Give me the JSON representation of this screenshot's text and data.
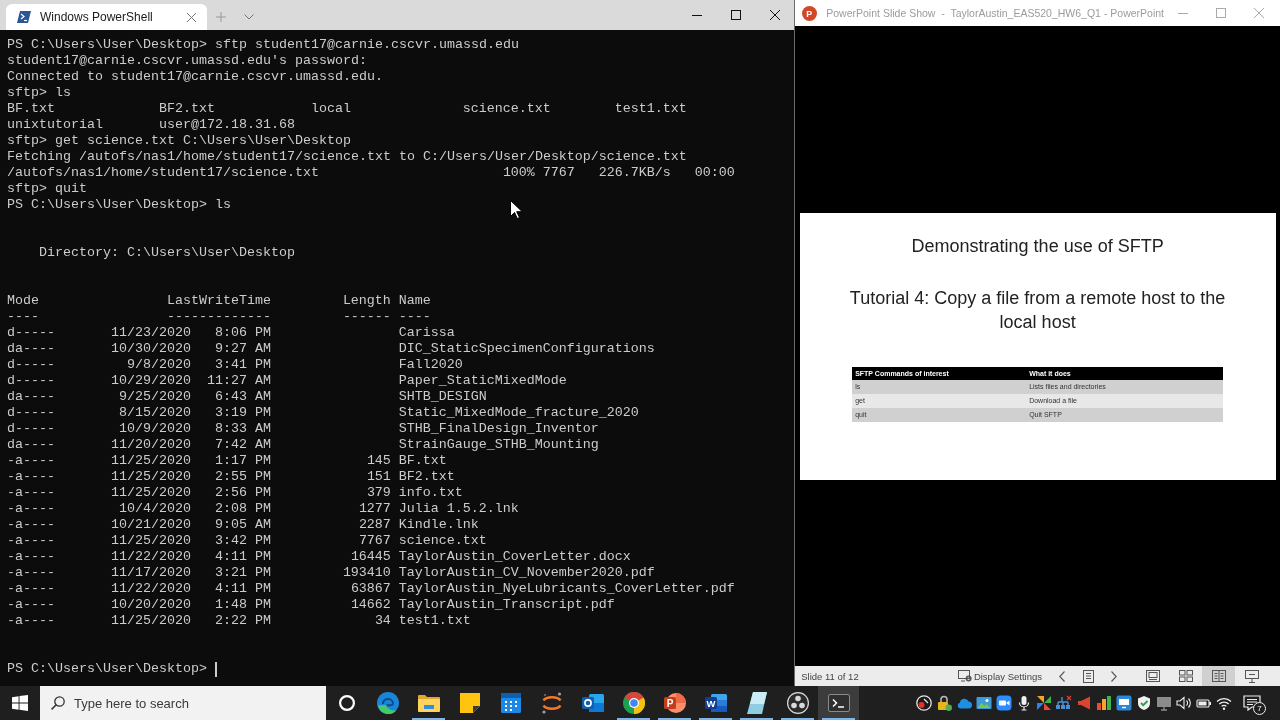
{
  "terminal": {
    "tab": {
      "title": "Windows PowerShell",
      "selected": true
    },
    "session": [
      {
        "kind": "text",
        "text": "PS C:\\Users\\User\\Desktop> sftp student17@carnie.cscvr.umassd.edu"
      },
      {
        "kind": "text",
        "text": "student17@carnie.cscvr.umassd.edu's password:"
      },
      {
        "kind": "text",
        "text": "Connected to student17@carnie.cscvr.umassd.edu."
      },
      {
        "kind": "text",
        "text": "sftp> ls"
      },
      {
        "kind": "columns",
        "cells": [
          "BF.txt",
          "BF2.txt",
          "local",
          "science.txt",
          "test1.txt"
        ]
      },
      {
        "kind": "columns",
        "cells": [
          "unixtutorial",
          "user@172.18.31.68"
        ]
      },
      {
        "kind": "text",
        "text": "sftp> get science.txt C:\\Users\\User\\Desktop"
      },
      {
        "kind": "text",
        "text": "Fetching /autofs/nas1/home/student17/science.txt to C:/Users/User/Desktop/science.txt"
      },
      {
        "kind": "transfer",
        "file": "/autofs/nas1/home/student17/science.txt",
        "percent": "100%",
        "size": "7767",
        "rate": "226.7KB/s",
        "eta": "00:00"
      },
      {
        "kind": "text",
        "text": "sftp> quit"
      },
      {
        "kind": "text",
        "text": "PS C:\\Users\\User\\Desktop> ls"
      }
    ],
    "directory": "Directory: C:\\Users\\User\\Desktop",
    "listing": {
      "columns": [
        "Mode",
        "LastWriteTime",
        "Length",
        "Name"
      ],
      "rules": [
        "----",
        "-------------",
        "------",
        "----"
      ],
      "rows": [
        {
          "mode": "d-----",
          "date": "11/23/2020",
          "time": "8:06 PM",
          "name": "Carissa"
        },
        {
          "mode": "da----",
          "date": "10/30/2020",
          "time": "9:27 AM",
          "name": "DIC_StaticSpecimenConfigurations"
        },
        {
          "mode": "d-----",
          "date": "9/8/2020",
          "time": "3:41 PM",
          "name": "Fall2020"
        },
        {
          "mode": "d-----",
          "date": "10/29/2020",
          "time": "11:27 AM",
          "name": "Paper_StaticMixedMode"
        },
        {
          "mode": "da----",
          "date": "9/25/2020",
          "time": "6:43 AM",
          "name": "SHTB_DESIGN"
        },
        {
          "mode": "d-----",
          "date": "8/15/2020",
          "time": "3:19 PM",
          "name": "Static_MixedMode_fracture_2020"
        },
        {
          "mode": "d-----",
          "date": "10/9/2020",
          "time": "8:33 AM",
          "name": "STHB_FinalDesign_Inventor"
        },
        {
          "mode": "da----",
          "date": "11/20/2020",
          "time": "7:42 AM",
          "name": "StrainGauge_STHB_Mounting"
        },
        {
          "mode": "-a----",
          "date": "11/25/2020",
          "time": "1:17 PM",
          "length": "145",
          "name": "BF.txt"
        },
        {
          "mode": "-a----",
          "date": "11/25/2020",
          "time": "2:55 PM",
          "length": "151",
          "name": "BF2.txt"
        },
        {
          "mode": "-a----",
          "date": "11/25/2020",
          "time": "2:56 PM",
          "length": "379",
          "name": "info.txt"
        },
        {
          "mode": "-a----",
          "date": "10/4/2020",
          "time": "2:08 PM",
          "length": "1277",
          "name": "Julia 1.5.2.lnk"
        },
        {
          "mode": "-a----",
          "date": "10/21/2020",
          "time": "9:05 AM",
          "length": "2287",
          "name": "Kindle.lnk"
        },
        {
          "mode": "-a----",
          "date": "11/25/2020",
          "time": "3:42 PM",
          "length": "7767",
          "name": "science.txt"
        },
        {
          "mode": "-a----",
          "date": "11/22/2020",
          "time": "4:11 PM",
          "length": "16445",
          "name": "TaylorAustin_CoverLetter.docx"
        },
        {
          "mode": "-a----",
          "date": "11/17/2020",
          "time": "3:21 PM",
          "length": "193410",
          "name": "TaylorAustin_CV_November2020.pdf"
        },
        {
          "mode": "-a----",
          "date": "11/22/2020",
          "time": "4:11 PM",
          "length": "63867",
          "name": "TaylorAustin_NyeLubricants_CoverLetter.pdf"
        },
        {
          "mode": "-a----",
          "date": "10/20/2020",
          "time": "1:48 PM",
          "length": "14662",
          "name": "TaylorAustin_Transcript.pdf"
        },
        {
          "mode": "-a----",
          "date": "11/25/2020",
          "time": "2:22 PM",
          "length": "34",
          "name": "test1.txt"
        }
      ]
    },
    "prompt": "PS C:\\Users\\User\\Desktop>"
  },
  "slideshow": {
    "icon_letter": "P",
    "title": "PowerPoint Slide Show  -  TaylorAustin_EAS520_HW6_Q1 - PowerPoint",
    "slide": {
      "heading": "Demonstrating the use of SFTP",
      "subheading": "Tutorial 4: Copy a file from a remote host to the local host",
      "table": {
        "columns": [
          "SFTP Commands of interest",
          "What it does"
        ],
        "rows": [
          [
            "ls",
            "Lists files and directories"
          ],
          [
            "get",
            "Download a file"
          ],
          [
            "quit",
            "Quit SFTP"
          ]
        ]
      }
    },
    "status_bar": {
      "slide_counter": "Slide 11 of 12",
      "display_settings": "Display Settings",
      "views": [
        {
          "kind": "normal",
          "selected": false
        },
        {
          "kind": "sorter",
          "selected": false
        },
        {
          "kind": "reading",
          "selected": true
        },
        {
          "kind": "slideshow",
          "selected": false
        }
      ]
    }
  },
  "taskbar": {
    "search": {
      "placeholder": "Type here to search"
    },
    "apps": [
      {
        "kind": "ring",
        "running": false,
        "selected": false
      },
      {
        "kind": "swirl",
        "running": false,
        "selected": false
      },
      {
        "kind": "folder",
        "running": true,
        "selected": false
      },
      {
        "kind": "note",
        "running": false,
        "selected": false
      },
      {
        "kind": "calendar",
        "running": false,
        "selected": false
      },
      {
        "kind": "orbit",
        "running": false,
        "selected": false
      },
      {
        "kind": "mail",
        "running": false,
        "selected": false
      },
      {
        "kind": "wheel",
        "running": true,
        "selected": false
      },
      {
        "kind": "slides",
        "letter": "P",
        "running": true,
        "selected": false
      },
      {
        "kind": "document",
        "letter": "W",
        "running": true,
        "selected": false
      },
      {
        "kind": "glass",
        "running": true,
        "selected": false
      },
      {
        "kind": "reel",
        "running": true,
        "selected": false
      },
      {
        "kind": "terminal",
        "running": true,
        "selected": true
      }
    ],
    "notifications": "7"
  }
}
